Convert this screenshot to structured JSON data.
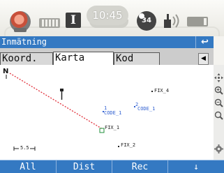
{
  "status": {
    "icons": [
      "prism-icon",
      "keyboard-icon",
      "text-mode-icon",
      "gnss-icon",
      "radio-icon",
      "battery-icon"
    ],
    "text_mode": "I",
    "time": "10:45",
    "gnss_label": "34"
  },
  "title": {
    "text": "Inmätning",
    "back_label": "↩"
  },
  "tabs": [
    {
      "label": "Koord."
    },
    {
      "label": "Karta"
    },
    {
      "label": "Kod"
    }
  ],
  "tab_scroll_label": "◀",
  "active_tab": "Karta",
  "map": {
    "north_label": "N",
    "points": [
      {
        "label": "FIX_4"
      },
      {
        "label": "1",
        "code": "CODE_1"
      },
      {
        "label": "2",
        "code": "CODE_1"
      },
      {
        "label": "FIX_1"
      },
      {
        "label": "FIX_2"
      }
    ],
    "scale_label": "5.5",
    "colors": {
      "line": "#e0303a",
      "point_blue": "#2f5fd1",
      "point_black": "#222222",
      "station": "#1f8f3a"
    }
  },
  "map_tools": [
    "pan-icon",
    "zoom-in-icon",
    "zoom-out-icon",
    "zoom-extents-icon",
    "settings-icon"
  ],
  "softkeys": [
    {
      "label": "All"
    },
    {
      "label": "Dist"
    },
    {
      "label": "Rec"
    },
    {
      "label": "↓"
    }
  ],
  "colors": {
    "accent": "#3479c2",
    "tab_bar": "#cccccc"
  }
}
